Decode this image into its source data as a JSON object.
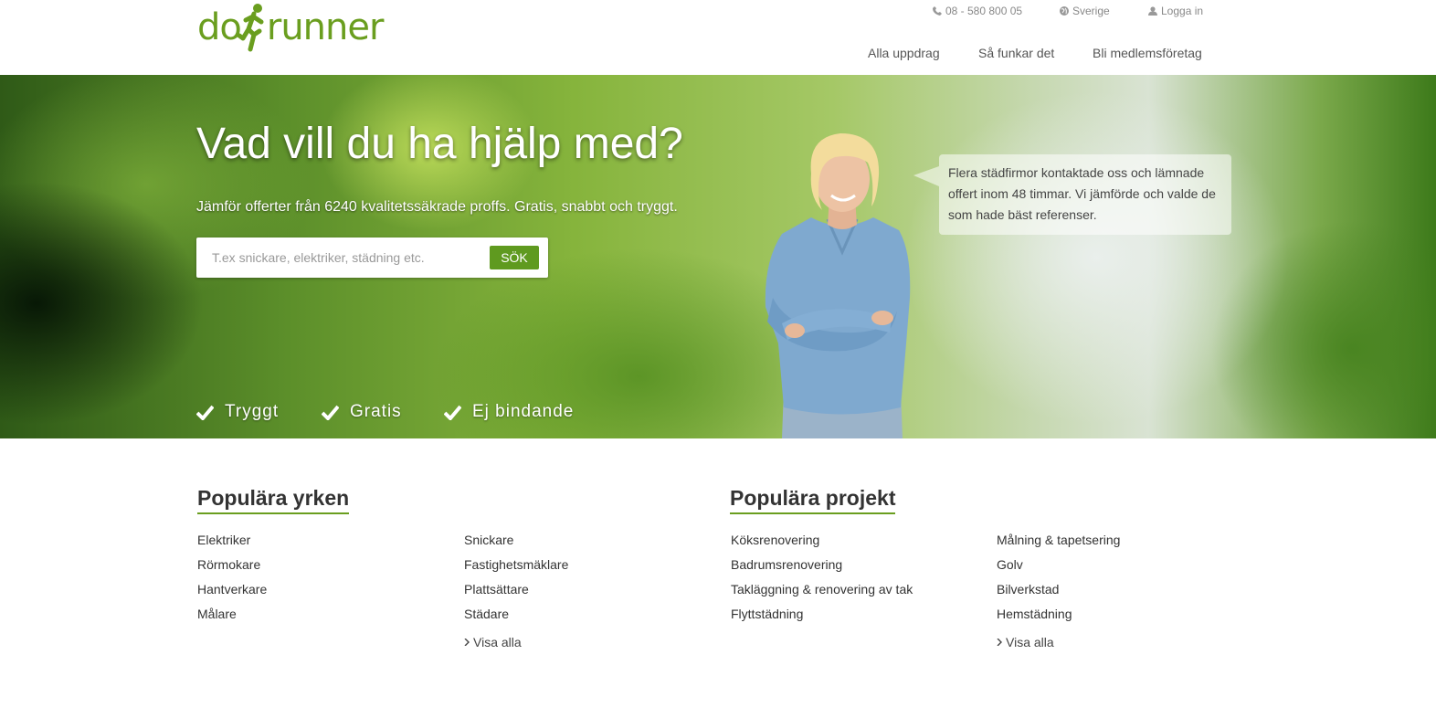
{
  "header": {
    "logo_text_1": "do",
    "logo_text_2": "runner",
    "phone": "08 - 580 800 05",
    "country": "Sverige",
    "login": "Logga in",
    "nav": [
      "Alla uppdrag",
      "Så funkar det",
      "Bli medlemsföretag"
    ]
  },
  "hero": {
    "title": "Vad vill du ha hjälp med?",
    "subtitle": "Jämför offerter från 6240 kvalitetssäkrade proffs. Gratis, snabbt och tryggt.",
    "search_placeholder": "T.ex snickare, elektriker, städning etc.",
    "search_button": "SÖK",
    "features": [
      "Tryggt",
      "Gratis",
      "Ej bindande"
    ],
    "testimonial": "Flera städfirmor kontaktade oss och lämnade offert inom 48 timmar. Vi jämförde och valde de som hade bäst referenser."
  },
  "popular_trades": {
    "title": "Populära yrken",
    "col1": [
      "Elektriker",
      "Rörmokare",
      "Hantverkare",
      "Målare"
    ],
    "col2": [
      "Snickare",
      "Fastighetsmäklare",
      "Plattsättare",
      "Städare"
    ],
    "show_all": "Visa alla"
  },
  "popular_projects": {
    "title": "Populära projekt",
    "col1": [
      "Köksrenovering",
      "Badrumsrenovering",
      "Takläggning & renovering av tak",
      "Flyttstädning"
    ],
    "col2": [
      "Målning & tapetsering",
      "Golv",
      "Bilverkstad",
      "Hemstädning"
    ],
    "show_all": "Visa alla"
  },
  "colors": {
    "brand_green": "#6a9e1f",
    "button_green": "#5f9a1f"
  },
  "icons": {
    "phone": "phone-icon",
    "globe": "globe-icon",
    "user": "user-icon",
    "check": "check-icon",
    "chevron": "chevron-right-icon",
    "runner": "runner-logo-icon"
  }
}
